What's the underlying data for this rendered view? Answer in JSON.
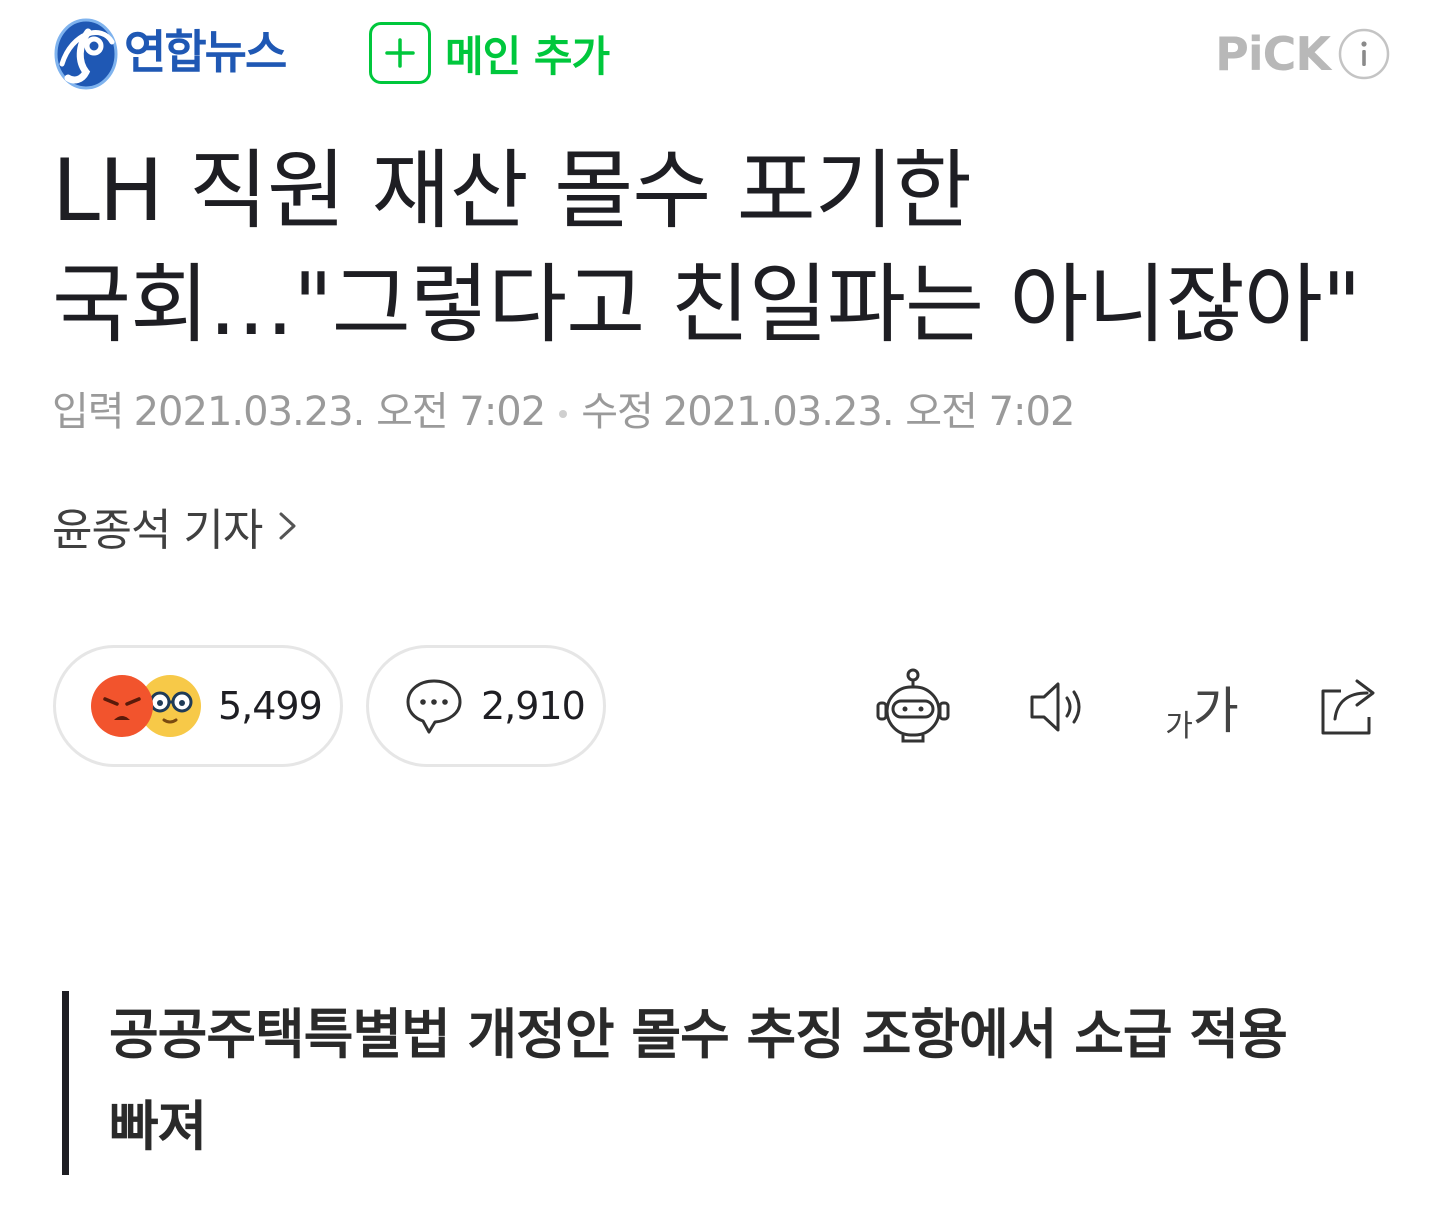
{
  "header": {
    "brand_name": "연합뉴스",
    "add_main_label": "메인 추가",
    "pick_label": "PiCK"
  },
  "article": {
    "headline": "LH 직원 재산 몰수 포기한 국회…\"그렇다고 친일파는 아니잖아\"",
    "input_label": "입력",
    "input_datetime": "2021.03.23. 오전 7:02",
    "modified_label": "수정",
    "modified_datetime": "2021.03.23. 오전 7:02",
    "reporter": "윤종석 기자",
    "subheading": "공공주택특별법 개정안 몰수 추징 조항에서 소급 적용 빠져"
  },
  "actions": {
    "reaction_count": "5,499",
    "comment_count": "2,910",
    "font_small_glyph": "가",
    "font_large_glyph": "가"
  },
  "icons": {
    "brand_logo": "yonhap-logo-icon",
    "plus": "plus-icon",
    "info": "info-icon",
    "chevron": "chevron-right-icon",
    "angry": "angry-face-icon",
    "nerd": "glasses-face-icon",
    "comment": "speech-bubble-icon",
    "summary": "robot-icon",
    "audio": "speaker-icon",
    "font": "font-size-icon",
    "share": "share-icon"
  },
  "colors": {
    "brand_blue": "#1f58b4",
    "green_accent": "#00c73c",
    "meta_gray": "#9a9a9a",
    "pick_gray": "#b8b8b8",
    "angry_red": "#f2542d",
    "nerd_yellow": "#f7c948"
  }
}
